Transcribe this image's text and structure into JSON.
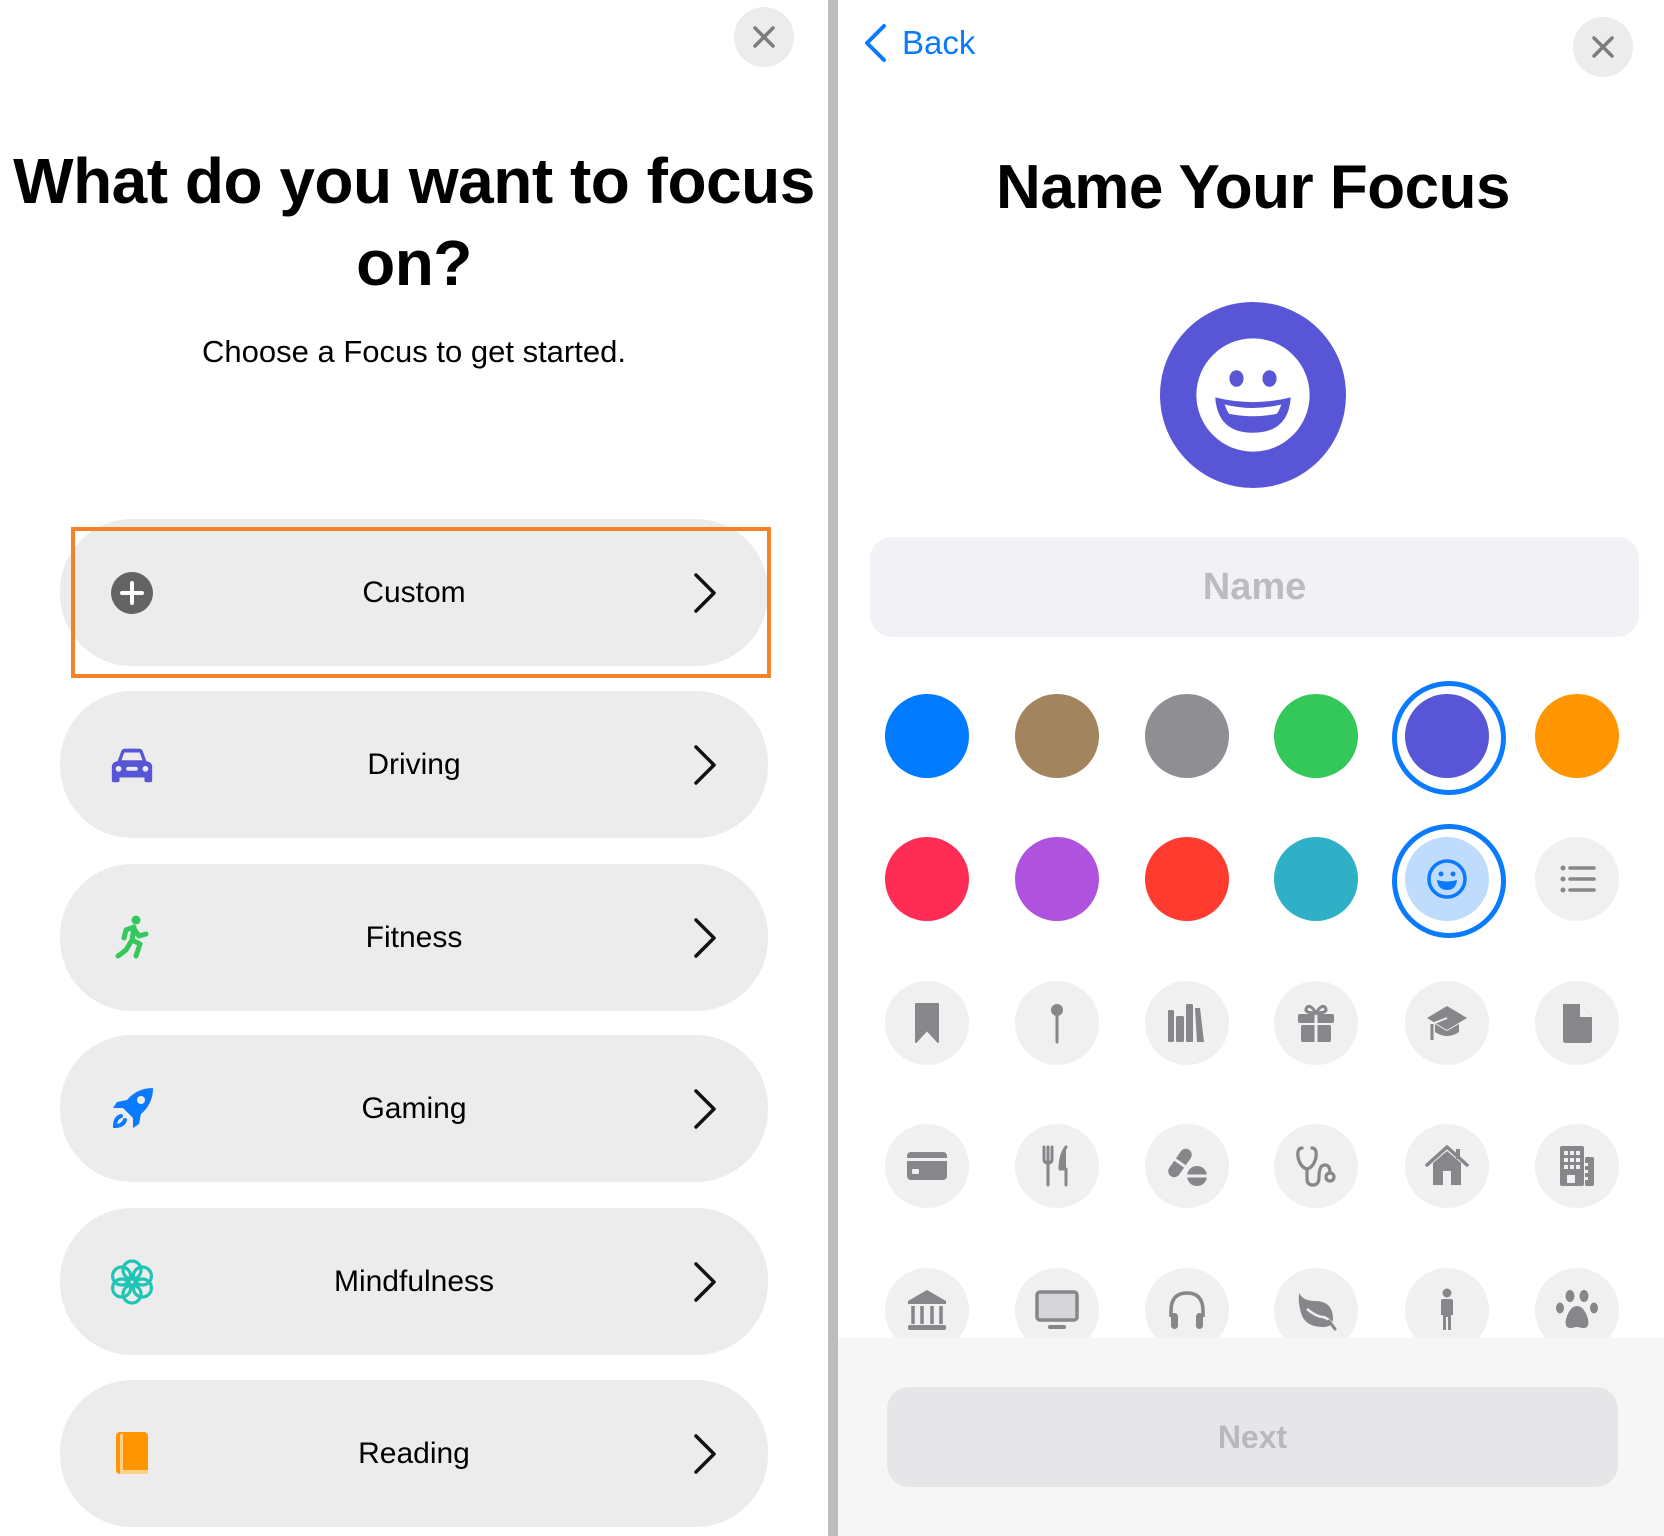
{
  "left": {
    "close_label": "Close",
    "title": "What do you want to focus on?",
    "subtitle": "Choose a Focus to get started.",
    "options": [
      {
        "label": "Custom",
        "icon": "plus-circle-icon",
        "color": "#636366",
        "highlighted": true
      },
      {
        "label": "Driving",
        "icon": "car-icon",
        "color": "#5856d6"
      },
      {
        "label": "Fitness",
        "icon": "running-figure-icon",
        "color": "#34c759"
      },
      {
        "label": "Gaming",
        "icon": "rocket-icon",
        "color": "#0a7aff"
      },
      {
        "label": "Mindfulness",
        "icon": "flower-icon",
        "color": "#1ec5b5"
      },
      {
        "label": "Reading",
        "icon": "book-icon",
        "color": "#ff9500"
      }
    ],
    "highlight_color": "#f5822b"
  },
  "right": {
    "back_label": "Back",
    "close_label": "Close",
    "title": "Name Your Focus",
    "selected_color": "#5856d6",
    "selected_icon": "smiley-icon",
    "name_placeholder": "Name",
    "name_value": "",
    "colors": [
      "#007aff",
      "#a2845e",
      "#8e8e93",
      "#34c759",
      "#5856d6",
      "#ff9500",
      "#ff2d55",
      "#af52de",
      "#ff3b30",
      "#30b0c7"
    ],
    "icons": [
      "smiley-icon",
      "list-icon",
      "bookmark-icon",
      "pin-icon",
      "books-icon",
      "gift-icon",
      "graduation-cap-icon",
      "document-icon",
      "credit-card-icon",
      "fork-knife-icon",
      "pills-icon",
      "stethoscope-icon",
      "house-icon",
      "building-icon",
      "bank-icon",
      "monitor-icon",
      "headphones-icon",
      "leaf-icon",
      "person-icon",
      "paw-icon"
    ],
    "next_label": "Next",
    "accent": "#0a7aff"
  }
}
